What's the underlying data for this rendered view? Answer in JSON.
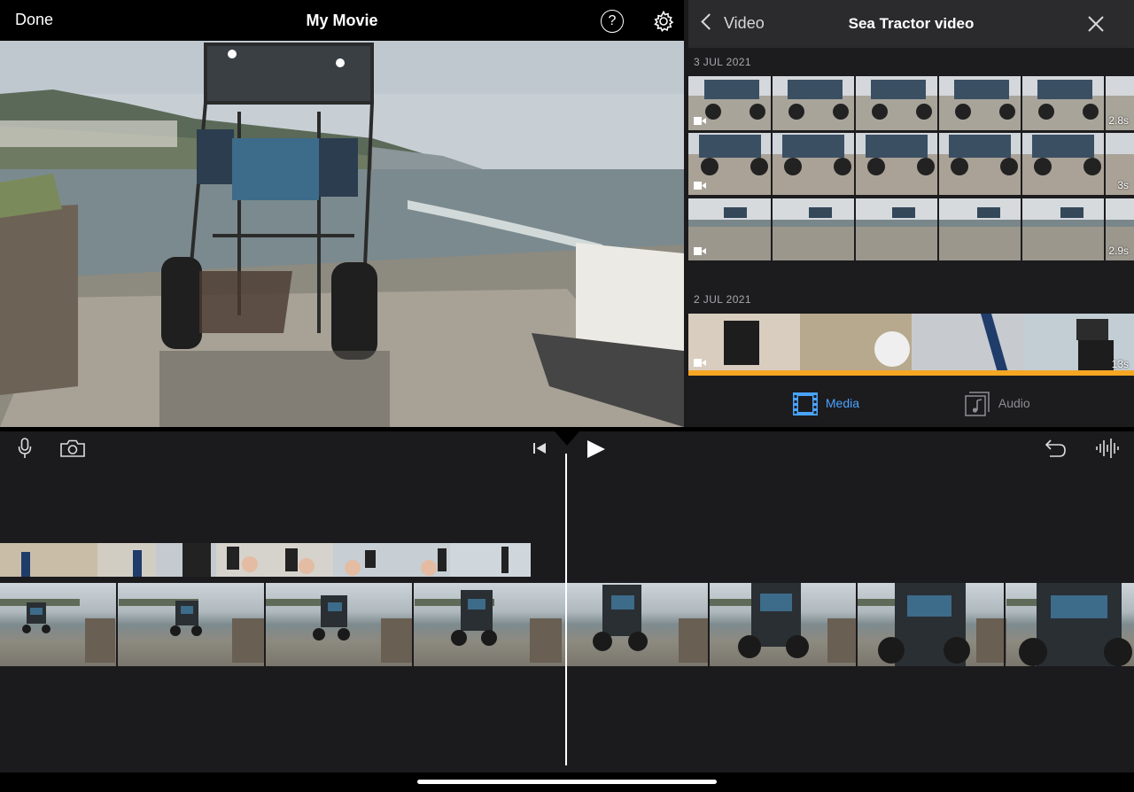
{
  "topbar": {
    "done_label": "Done",
    "title": "My Movie",
    "help_label": "?"
  },
  "browser": {
    "back_label": "Video",
    "title": "Sea Tractor video",
    "groups": [
      {
        "date": "3 JUL 2021",
        "clips": [
          {
            "duration": "2.8s"
          },
          {
            "duration": "3s"
          },
          {
            "duration": "2.9s"
          }
        ]
      },
      {
        "date": "2 JUL 2021",
        "clips": [
          {
            "duration": "13s",
            "selected": true
          }
        ]
      }
    ],
    "tabs": [
      {
        "label": "Media",
        "active": true
      },
      {
        "label": "Audio",
        "active": false
      }
    ]
  },
  "colors": {
    "accent": "#4aa3ff",
    "selection": "#f5a623",
    "background": "#1b1b1d"
  }
}
